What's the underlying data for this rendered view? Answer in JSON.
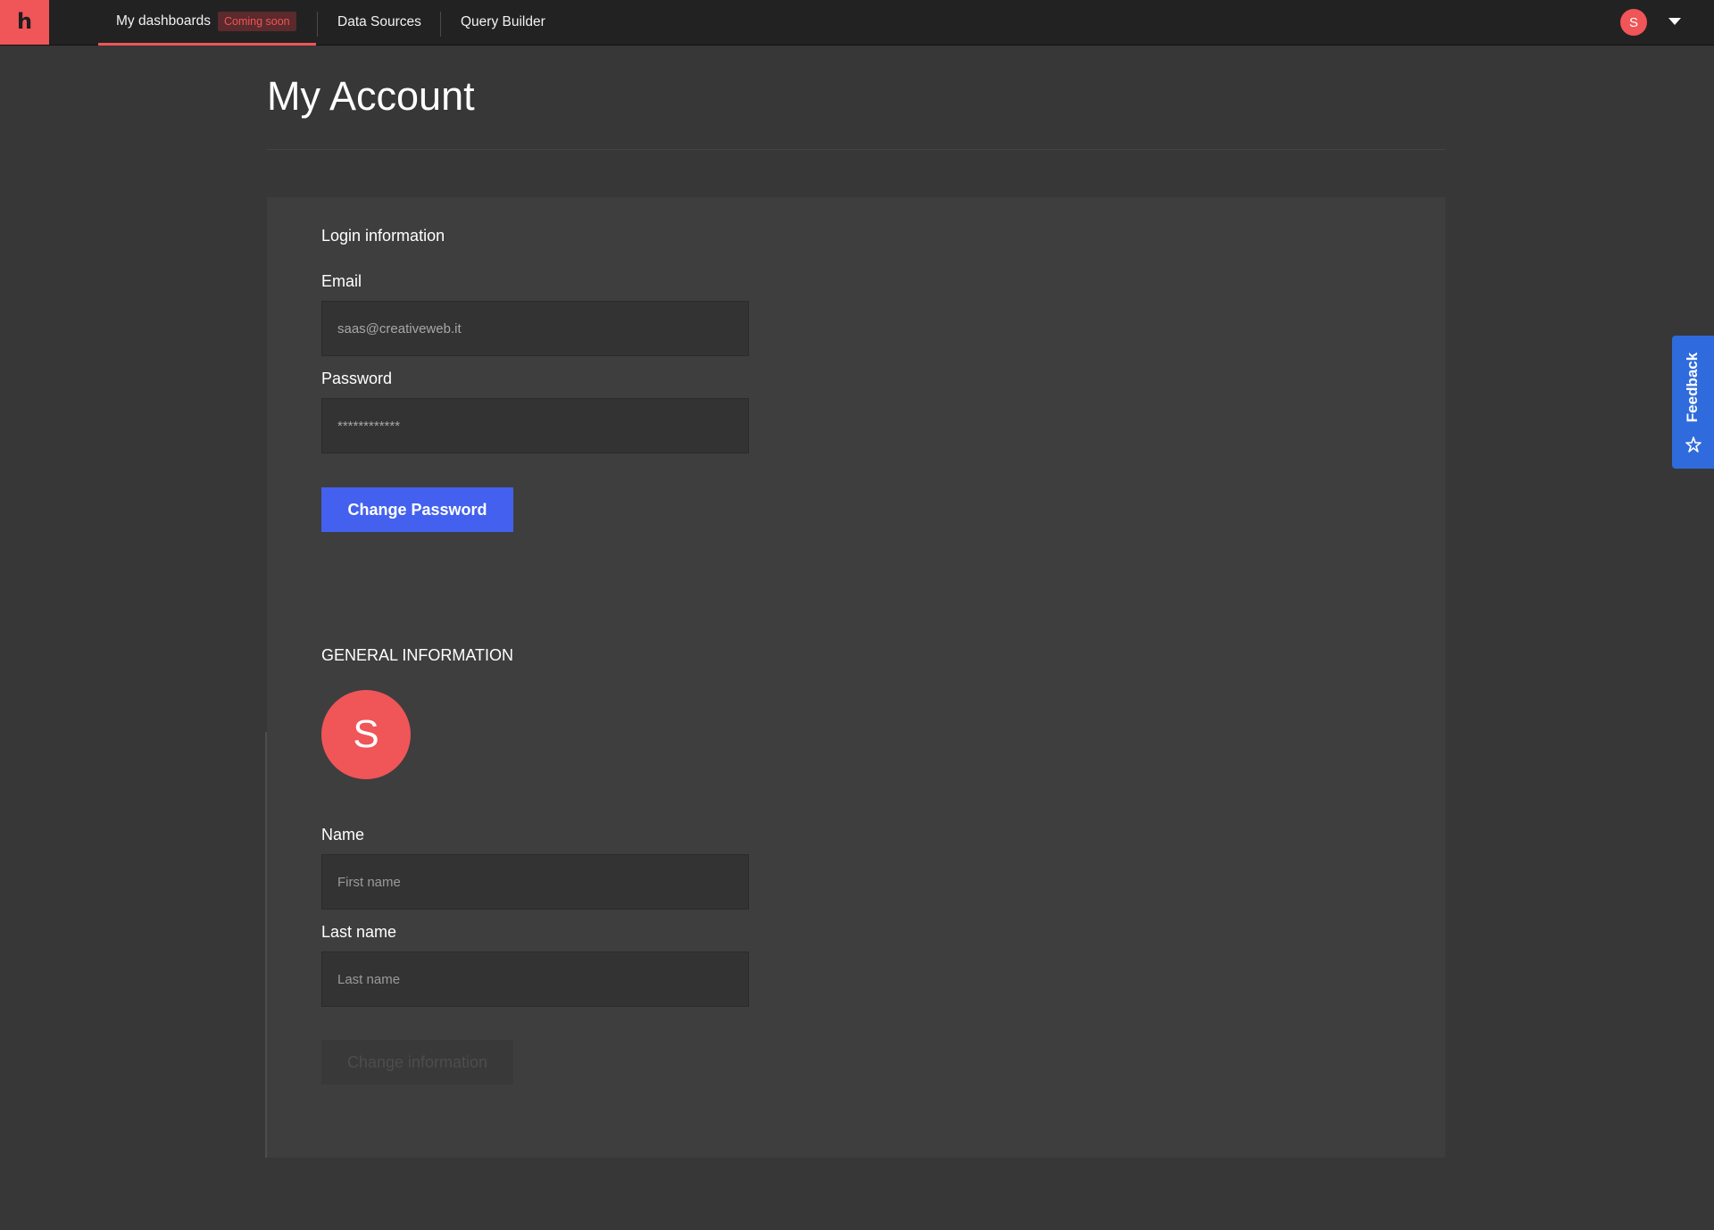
{
  "nav": {
    "logo_letter": "h",
    "items": [
      {
        "label": "My dashboards",
        "badge": "Coming soon"
      },
      {
        "label": "Data Sources"
      },
      {
        "label": "Query Builder"
      }
    ],
    "user_initial": "S",
    "menu_icon": "chevron-down-icon"
  },
  "page": {
    "title": "My Account"
  },
  "login": {
    "section_title": "Login information",
    "email_label": "Email",
    "email_value": "saas@creativeweb.it",
    "password_label": "Password",
    "password_value": "************",
    "change_password_label": "Change Password"
  },
  "general": {
    "section_title": "GENERAL INFORMATION",
    "avatar_initial": "S",
    "name_label": "Name",
    "first_name_placeholder": "First name",
    "last_name_label": "Last name",
    "last_name_placeholder": "Last name",
    "change_information_label": "Change information"
  },
  "feedback": {
    "label": "Feedback",
    "icon": "sparkle-star-icon"
  },
  "colors": {
    "brand": "#f05558",
    "primary_button": "#4361ee",
    "feedback_tab": "#2f6bdc",
    "background": "#373737",
    "card": "#3e3e3e"
  }
}
